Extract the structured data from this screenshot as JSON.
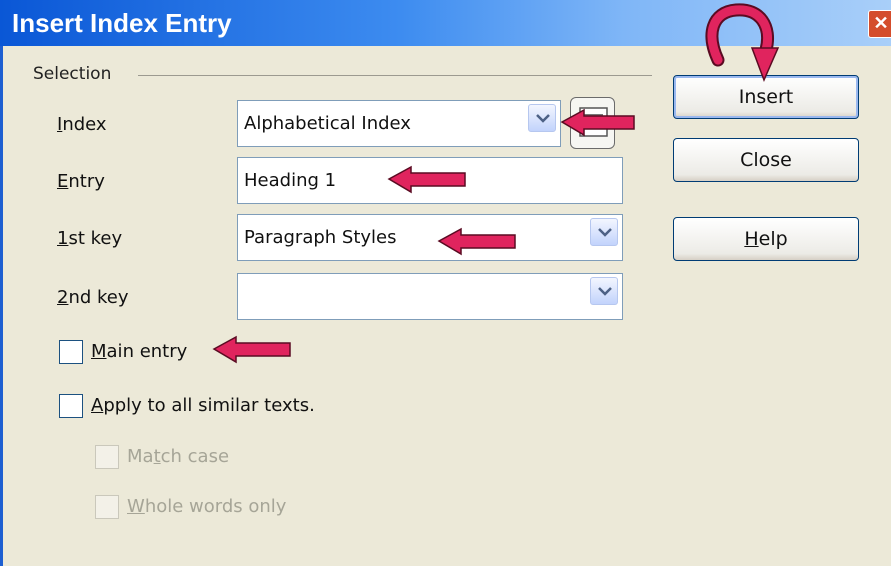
{
  "window": {
    "title": "Insert Index Entry",
    "close_glyph": "✕"
  },
  "selection": {
    "section_label": "Selection",
    "index": {
      "label_u": "I",
      "label_rest": "ndex",
      "value": "Alphabetical Index"
    },
    "entry": {
      "label_u": "E",
      "label_rest": "ntry",
      "value": "Heading 1"
    },
    "key1": {
      "label_u": "1",
      "label_rest": "st key",
      "value": "Paragraph Styles"
    },
    "key2": {
      "label_u": "2",
      "label_rest": "nd key",
      "value": ""
    }
  },
  "options": {
    "main_entry": {
      "label_u": "M",
      "label_rest": "ain entry",
      "checked": false
    },
    "apply_all": {
      "label_u": "A",
      "label_rest": "pply to all similar texts.",
      "checked": false
    },
    "match_case": {
      "label_pre": "Ma",
      "label_u": "t",
      "label_rest": "ch case",
      "checked": false,
      "enabled": false
    },
    "whole_words": {
      "label_u": "W",
      "label_rest": "hole words only",
      "checked": false,
      "enabled": false
    }
  },
  "buttons": {
    "insert": "Insert",
    "close": "Close",
    "help_u": "H",
    "help_rest": "elp"
  },
  "icons": {
    "dropdown": "chevron-down-icon",
    "new_index": "new-user-defined-index-icon",
    "annotation": "red-arrow-icon",
    "curved": "curved-arrow-icon"
  },
  "colors": {
    "title_bar": "#0a57d6",
    "dialog_bg": "#ece9d8",
    "arrow": "#e0245e"
  }
}
